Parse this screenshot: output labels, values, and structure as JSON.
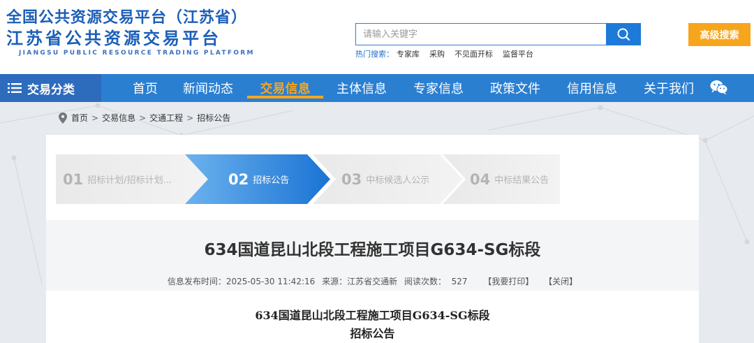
{
  "logo": {
    "line1": "全国公共资源交易平台（江苏省）",
    "line2": "江苏省公共资源交易平台",
    "line3": "JIANGSU PUBLIC RESOURCE TRADING PLATFORM"
  },
  "search": {
    "placeholder": "请输入关键字",
    "hot_label": "热门搜索：",
    "hot_items": [
      "专家库",
      "采购",
      "不见面开标",
      "监督平台"
    ],
    "advanced_label": "高级搜索"
  },
  "nav": {
    "category_label": "交易分类",
    "items": [
      "首页",
      "新闻动态",
      "交易信息",
      "主体信息",
      "专家信息",
      "政策文件",
      "信用信息",
      "关于我们"
    ],
    "active_index": 2
  },
  "breadcrumb": [
    "首页",
    "交易信息",
    "交通工程",
    "招标公告"
  ],
  "steps": [
    {
      "num": "01",
      "label": "招标计划/招标计划..."
    },
    {
      "num": "02",
      "label": "招标公告"
    },
    {
      "num": "03",
      "label": "中标候选人公示"
    },
    {
      "num": "04",
      "label": "中标结果公告"
    }
  ],
  "active_step": 1,
  "article": {
    "title": "634国道昆山北段工程施工项目G634-SG标段",
    "publish_time": "信息发布时间：2025-05-30 11:42:16",
    "source": "来源：江苏省交通新",
    "views": "阅读次数：  527",
    "print_label": "【我要打印】",
    "close_label": "【关闭】",
    "doc_title": "634国道昆山北段工程施工项目G634-SG标段",
    "doc_subtitle": "招标公告"
  },
  "colors": {
    "brand_blue": "#1c5fb8",
    "nav_blue": "#2a7fd1",
    "accent_orange": "#f7a51c"
  }
}
